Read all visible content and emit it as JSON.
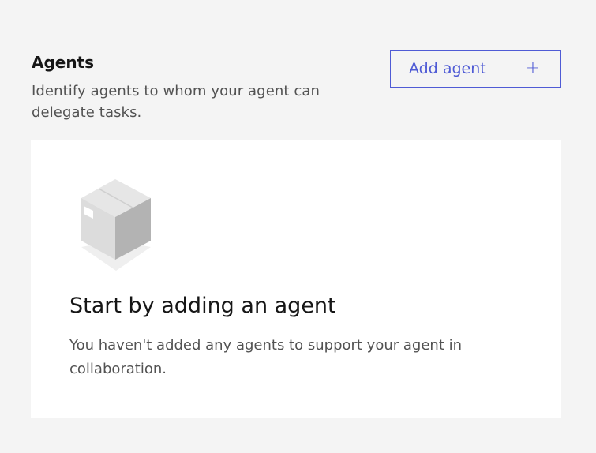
{
  "agents_section": {
    "title": "Agents",
    "description": "Identify agents to whom your agent can delegate tasks.",
    "add_button_label": "Add agent",
    "add_button_icon": "plus-icon",
    "add_button_glyph": "+"
  },
  "empty_state": {
    "illustration": "box-icon",
    "title": "Start by adding an agent",
    "description": "You haven't added any agents to support your agent in collaboration."
  },
  "colors": {
    "background": "#f4f4f4",
    "card": "#ffffff",
    "accent": "#4f5bd5",
    "text_primary": "#161616",
    "text_secondary": "#525252"
  }
}
